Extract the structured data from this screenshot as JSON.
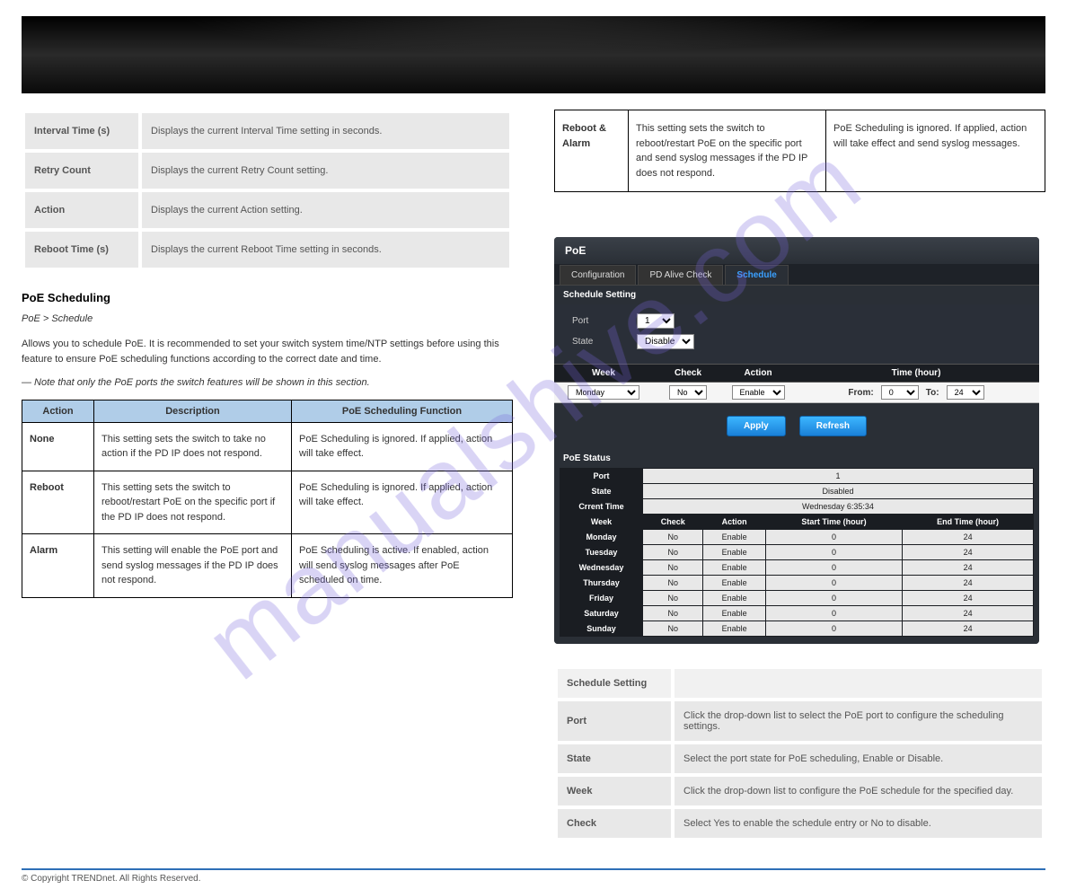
{
  "watermark": "manualshive.com",
  "left": {
    "grey": [
      {
        "label": "Interval Time (s)",
        "desc": "Displays the current Interval Time setting in seconds."
      },
      {
        "label": "Retry Count",
        "desc": "Displays the current Retry Count setting."
      },
      {
        "label": "Action",
        "desc": "Displays the current Action setting."
      },
      {
        "label": "Reboot Time (s)",
        "desc": "Displays the current Reboot Time setting in seconds."
      }
    ],
    "heading": "PoE Scheduling",
    "nav": "PoE > Schedule",
    "p1": "Allows you to schedule PoE. It is recommended to set your switch system time/NTP settings before using this feature to ensure PoE scheduling functions according to the correct date and time.",
    "p2text": "— Note that only the PoE ports the switch features will be shown in this section.",
    "bluetable": {
      "header": [
        "Action",
        "Description",
        "PoE Scheduling Function"
      ],
      "rows": [
        {
          "action": "None",
          "desc": "This setting sets the switch to take no action if the PD IP does not respond.",
          "func": "PoE Scheduling is ignored. If applied, action will take effect."
        },
        {
          "action": "Reboot",
          "desc": "This setting sets the switch to reboot/restart PoE on the specific port if the PD IP does not respond.",
          "func": "PoE Scheduling is ignored. If applied, action will take effect."
        },
        {
          "action": "Alarm",
          "desc": "This setting will enable the PoE port and send syslog messages if the PD IP does not respond.",
          "func": "PoE Scheduling is active. If enabled, action will send syslog messages after PoE scheduled on time."
        }
      ]
    }
  },
  "right": {
    "plaintable": {
      "rows": [
        {
          "action": "Reboot & Alarm",
          "desc": "This setting sets the switch to reboot/restart PoE on the specific port and send syslog messages if the PD IP does not respond.",
          "func": "PoE Scheduling is ignored. If applied, action will take effect and send syslog messages."
        }
      ]
    },
    "app": {
      "title": "PoE",
      "tabs": [
        "Configuration",
        "PD Alive Check",
        "Schedule"
      ],
      "activeTab": 2,
      "sub1": "Schedule Setting",
      "form": {
        "portLabel": "Port",
        "portValue": "1",
        "stateLabel": "State",
        "stateValue": "Disable"
      },
      "gridHead": [
        "Week",
        "Check",
        "Action",
        "Time (hour)"
      ],
      "gridRow": {
        "week": "Monday",
        "check": "No",
        "action": "Enable",
        "fromLabel": "From:",
        "from": "0",
        "toLabel": "To:",
        "to": "24"
      },
      "btnApply": "Apply",
      "btnRefresh": "Refresh",
      "sub2": "PoE Status",
      "status": {
        "rows1": [
          {
            "h": "Port",
            "v": "1"
          },
          {
            "h": "State",
            "v": "Disabled"
          },
          {
            "h": "Crrent Time",
            "v": "Wednesday 6:35:34"
          }
        ],
        "headers2": [
          "Week",
          "Check",
          "Action",
          "Start Time (hour)",
          "End Time (hour)"
        ],
        "days": [
          {
            "w": "Monday",
            "c": "No",
            "a": "Enable",
            "s": "0",
            "e": "24"
          },
          {
            "w": "Tuesday",
            "c": "No",
            "a": "Enable",
            "s": "0",
            "e": "24"
          },
          {
            "w": "Wednesday",
            "c": "No",
            "a": "Enable",
            "s": "0",
            "e": "24"
          },
          {
            "w": "Thursday",
            "c": "No",
            "a": "Enable",
            "s": "0",
            "e": "24"
          },
          {
            "w": "Friday",
            "c": "No",
            "a": "Enable",
            "s": "0",
            "e": "24"
          },
          {
            "w": "Saturday",
            "c": "No",
            "a": "Enable",
            "s": "0",
            "e": "24"
          },
          {
            "w": "Sunday",
            "c": "No",
            "a": "Enable",
            "s": "0",
            "e": "24"
          }
        ]
      }
    },
    "settings": {
      "head": [
        "Schedule Setting",
        ""
      ],
      "rows": [
        {
          "label": "Port",
          "desc": "Click the drop-down list to select the PoE port to configure the scheduling settings."
        },
        {
          "label": "State",
          "desc": "Select the port state for PoE scheduling, Enable or Disable."
        },
        {
          "label": "Week",
          "desc": "Click the drop-down list to configure the PoE schedule for the specified day."
        },
        {
          "label": "Check",
          "desc": "Select Yes to enable the schedule entry or No to disable."
        }
      ]
    }
  },
  "footer": {
    "left": "© Copyright TRENDnet. All Rights Reserved.",
    "right": ""
  }
}
